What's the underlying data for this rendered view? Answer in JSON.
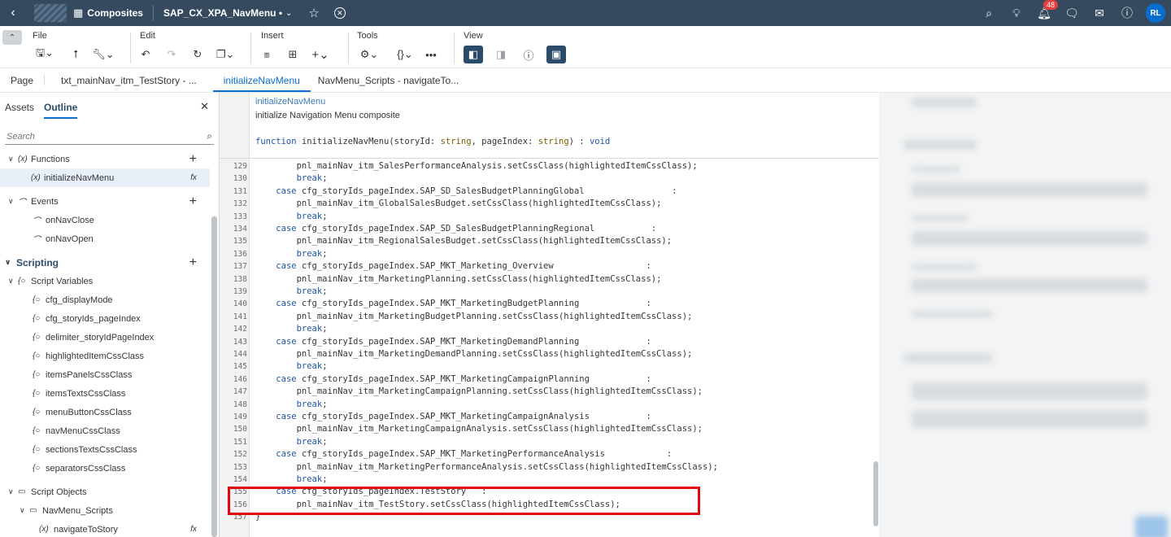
{
  "shell": {
    "app_name": "Composites",
    "doc_name": "SAP_CX_XPA_NavMenu",
    "doc_modified_marker": "•",
    "notification_count": "48",
    "avatar_initials": "RL"
  },
  "toolbar": {
    "groups": {
      "file": "File",
      "edit": "Edit",
      "insert": "Insert",
      "tools": "Tools",
      "view": "View"
    }
  },
  "tabs": [
    "Page",
    "txt_mainNav_itm_TestStory - ...",
    "initializeNavMenu",
    "NavMenu_Scripts - navigateTo..."
  ],
  "left": {
    "tabs": [
      "Assets",
      "Outline"
    ],
    "search_placeholder": "Search",
    "tree": {
      "functions": "Functions",
      "fn_initialize": "initializeNavMenu",
      "events": "Events",
      "ev_close": "onNavClose",
      "ev_open": "onNavOpen",
      "scripting": "Scripting",
      "script_variables": "Script Variables",
      "variables": [
        "cfg_displayMode",
        "cfg_storyIds_pageIndex",
        "delimiter_storyIdPageIndex",
        "highlightedItemCssClass",
        "itemsPanelsCssClass",
        "itemsTextsCssClass",
        "menuButtonCssClass",
        "navMenuCssClass",
        "sectionsTextsCssClass",
        "separatorsCssClass"
      ],
      "script_objects": "Script Objects",
      "navmenu_scripts": "NavMenu_Scripts",
      "navigate_to_story": "navigateToStory"
    }
  },
  "editor": {
    "function_name": "initializeNavMenu",
    "function_desc": "initialize Navigation Menu composite",
    "signature": {
      "kw": "function",
      "name": " initializeNavMenu(storyId: ",
      "t1": "string",
      "mid": ", pageIndex: ",
      "t2": "string",
      "end": ") : ",
      "ret": "void"
    },
    "lines": [
      {
        "n": "129",
        "indent": "        ",
        "text": "pnl_mainNav_itm_SalesPerformanceAnalysis.setCssClass(highlightedItemCssClass);"
      },
      {
        "n": "130",
        "indent": "        ",
        "kw": "break",
        "text": ";"
      },
      {
        "n": "131",
        "indent": "    ",
        "kw": "case",
        "text": " cfg_storyIds_pageIndex.SAP_SD_SalesBudgetPlanningGlobal                 :"
      },
      {
        "n": "132",
        "indent": "        ",
        "text": "pnl_mainNav_itm_GlobalSalesBudget.setCssClass(highlightedItemCssClass);"
      },
      {
        "n": "133",
        "indent": "        ",
        "kw": "break",
        "text": ";"
      },
      {
        "n": "134",
        "indent": "    ",
        "kw": "case",
        "text": " cfg_storyIds_pageIndex.SAP_SD_SalesBudgetPlanningRegional           :"
      },
      {
        "n": "135",
        "indent": "        ",
        "text": "pnl_mainNav_itm_RegionalSalesBudget.setCssClass(highlightedItemCssClass);"
      },
      {
        "n": "136",
        "indent": "        ",
        "kw": "break",
        "text": ";"
      },
      {
        "n": "137",
        "indent": "    ",
        "kw": "case",
        "text": " cfg_storyIds_pageIndex.SAP_MKT_Marketing_Overview                  :"
      },
      {
        "n": "138",
        "indent": "        ",
        "text": "pnl_mainNav_itm_MarketingPlanning.setCssClass(highlightedItemCssClass);"
      },
      {
        "n": "139",
        "indent": "        ",
        "kw": "break",
        "text": ";"
      },
      {
        "n": "140",
        "indent": "    ",
        "kw": "case",
        "text": " cfg_storyIds_pageIndex.SAP_MKT_MarketingBudgetPlanning             :"
      },
      {
        "n": "141",
        "indent": "        ",
        "text": "pnl_mainNav_itm_MarketingBudgetPlanning.setCssClass(highlightedItemCssClass);"
      },
      {
        "n": "142",
        "indent": "        ",
        "kw": "break",
        "text": ";"
      },
      {
        "n": "143",
        "indent": "    ",
        "kw": "case",
        "text": " cfg_storyIds_pageIndex.SAP_MKT_MarketingDemandPlanning             :"
      },
      {
        "n": "144",
        "indent": "        ",
        "text": "pnl_mainNav_itm_MarketingDemandPlanning.setCssClass(highlightedItemCssClass);"
      },
      {
        "n": "145",
        "indent": "        ",
        "kw": "break",
        "text": ";"
      },
      {
        "n": "146",
        "indent": "    ",
        "kw": "case",
        "text": " cfg_storyIds_pageIndex.SAP_MKT_MarketingCampaignPlanning           :"
      },
      {
        "n": "147",
        "indent": "        ",
        "text": "pnl_mainNav_itm_MarketingCampaignPlanning.setCssClass(highlightedItemCssClass);"
      },
      {
        "n": "148",
        "indent": "        ",
        "kw": "break",
        "text": ";"
      },
      {
        "n": "149",
        "indent": "    ",
        "kw": "case",
        "text": " cfg_storyIds_pageIndex.SAP_MKT_MarketingCampaignAnalysis           :"
      },
      {
        "n": "150",
        "indent": "        ",
        "text": "pnl_mainNav_itm_MarketingCampaignAnalysis.setCssClass(highlightedItemCssClass);"
      },
      {
        "n": "151",
        "indent": "        ",
        "kw": "break",
        "text": ";"
      },
      {
        "n": "152",
        "indent": "    ",
        "kw": "case",
        "text": " cfg_storyIds_pageIndex.SAP_MKT_MarketingPerformanceAnalysis            :"
      },
      {
        "n": "153",
        "indent": "        ",
        "text": "pnl_mainNav_itm_MarketingPerformanceAnalysis.setCssClass(highlightedItemCssClass);"
      },
      {
        "n": "154",
        "indent": "        ",
        "kw": "break",
        "text": ";"
      },
      {
        "n": "155",
        "indent": "    ",
        "kw": "case",
        "text": " cfg_storyIds_pageIndex.TestStory   :"
      },
      {
        "n": "156",
        "indent": "        ",
        "text": "pnl_mainNav_itm_TestStory.setCssClass(highlightedItemCssClass);"
      },
      {
        "n": "157",
        "indent": "",
        "text": "}"
      }
    ]
  },
  "colors": {
    "shell": "#354a5f",
    "accent": "#0a6ed1",
    "highlight_box": "#e3000f",
    "keyword": "#1f55a8"
  }
}
